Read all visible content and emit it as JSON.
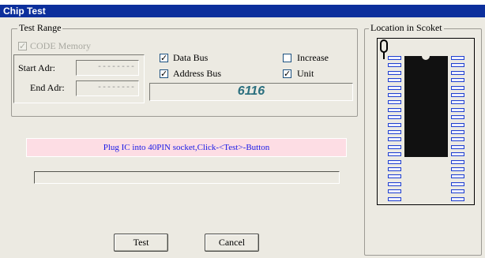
{
  "window": {
    "title": "Chip Test"
  },
  "test_range": {
    "legend": "Test Range",
    "code_memory": {
      "label": "CODE Memory",
      "checked": true,
      "disabled": true
    },
    "start_addr": {
      "label": "Start Adr:",
      "value": "--------"
    },
    "end_addr": {
      "label": "End Adr:",
      "value": "--------"
    },
    "data_bus": {
      "label": "Data Bus",
      "checked": true
    },
    "address_bus": {
      "label": "Address Bus",
      "checked": true
    },
    "increase": {
      "label": "Increase",
      "checked": false
    },
    "unit": {
      "label": "Unit",
      "checked": true
    },
    "chip_name": "6116"
  },
  "socket": {
    "legend": "Location in Scoket",
    "pins_per_side": 20
  },
  "message": "Plug IC into 40PIN socket,Click-<Test>-Button",
  "progress": {
    "value": 0
  },
  "buttons": {
    "test": "Test",
    "cancel": "Cancel"
  },
  "colors": {
    "titlebar": "#0c2f9c",
    "dialog_bg": "#eceae2",
    "message_bg": "#fddde4",
    "message_text": "#1a1ae6",
    "chip_name": "#2a6f7e",
    "pin_outline": "#1f3fd0"
  }
}
